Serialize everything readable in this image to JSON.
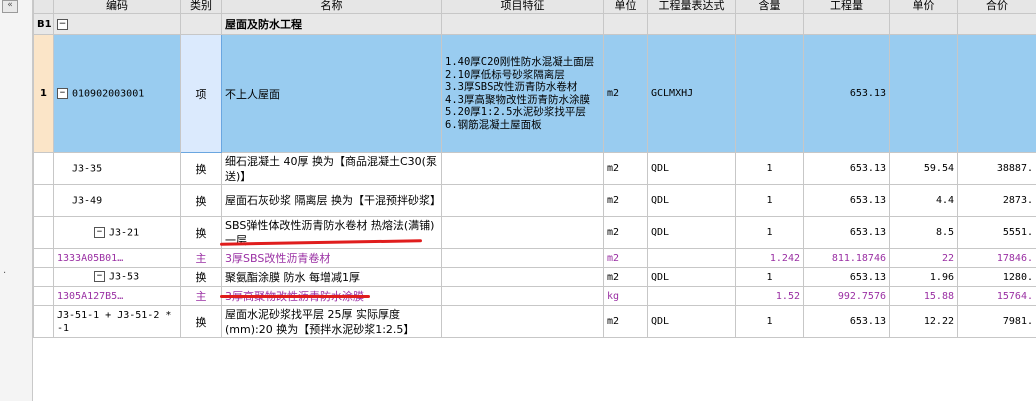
{
  "headers": [
    "编码",
    "类别",
    "名称",
    "项目特征",
    "单位",
    "工程量表达式",
    "含量",
    "工程量",
    "单价",
    "合价"
  ],
  "collapse_glyph": "«",
  "side_dot": ".",
  "section": {
    "num": "B1",
    "toggle": "−",
    "name": "屋面及防水工程"
  },
  "main_item": {
    "num": "1",
    "toggle": "−",
    "code": "010902003001",
    "type": "项",
    "name": "不上人屋面",
    "features": [
      "1.40厚C20刚性防水混凝土面层",
      "2.10厚低标号砂浆隔离层",
      "3.3厚SBS改性沥青防水卷材",
      "4.3厚高聚物改性沥青防水涂膜",
      "5.20厚1:2.5水泥砂浆找平层",
      "6.钢筋混凝土屋面板"
    ],
    "unit": "m2",
    "expr": "GCLMXHJ",
    "qty": "653.13"
  },
  "rows": [
    {
      "toggle": "",
      "code": "J3-35",
      "type": "换",
      "name": "细石混凝土 40厚  换为【商品混凝土C30(泵送)】",
      "unit": "m2",
      "expr": "QDL",
      "content": "1",
      "qty": "653.13",
      "price": "59.54",
      "total": "38887."
    },
    {
      "toggle": "",
      "code": "J3-49",
      "type": "换",
      "name": "屋面石灰砂浆 隔离层  换为【干混预拌砂浆】",
      "unit": "m2",
      "expr": "QDL",
      "content": "1",
      "qty": "653.13",
      "price": "4.4",
      "total": "2873."
    },
    {
      "toggle": "−",
      "code": "J3-21",
      "type": "换",
      "name": "SBS弹性体改性沥青防水卷材 热熔法(满铺) 一层",
      "unit": "m2",
      "expr": "QDL",
      "content": "1",
      "qty": "653.13",
      "price": "8.5",
      "total": "5551."
    },
    {
      "toggle": "",
      "code": "1333A05B01…",
      "type": "主",
      "name": "3厚SBS改性沥青卷材",
      "unit": "m2",
      "expr": "",
      "content": "1.242",
      "qty": "811.18746",
      "price": "22",
      "total": "17846.",
      "main": true
    },
    {
      "toggle": "−",
      "code": "J3-53",
      "type": "换",
      "name": "聚氨酯涂膜 防水 每增减1厚",
      "unit": "m2",
      "expr": "QDL",
      "content": "1",
      "qty": "653.13",
      "price": "1.96",
      "total": "1280."
    },
    {
      "toggle": "",
      "code": "1305A127B5…",
      "type": "主",
      "name": "3厚高聚物改性沥青防水涂膜",
      "unit": "kg",
      "expr": "",
      "content": "1.52",
      "qty": "992.7576",
      "price": "15.88",
      "total": "15764.",
      "main": true
    },
    {
      "toggle": "",
      "code": "J3-51-1 + J3-51-2 * -1",
      "type": "换",
      "name": "屋面水泥砂浆找平层 25厚  实际厚度(mm):20  换为【预拌水泥砂浆1:2.5】",
      "unit": "m2",
      "expr": "QDL",
      "content": "1",
      "qty": "653.13",
      "price": "12.22",
      "total": "7981."
    }
  ],
  "colors": {
    "selected_row": "#99ccf0",
    "main_material_text": "#9a2fa3",
    "annotation_line": "#e01d1d",
    "row_number_bg": "#fbe5c8"
  }
}
